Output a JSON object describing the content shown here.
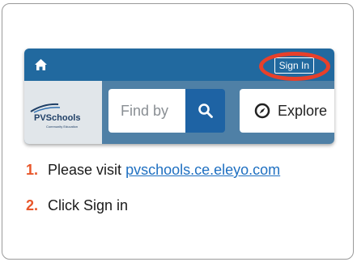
{
  "screenshot": {
    "signin_label": "Sign In",
    "logo_text": "PVSchools",
    "logo_subtext": "Community Education",
    "search_placeholder": "Find by",
    "explore_label": "Explore"
  },
  "steps": [
    {
      "number": "1.",
      "text": "Please visit ",
      "link": "pvschools.ce.eleyo.com"
    },
    {
      "number": "2.",
      "text": "Click Sign in"
    }
  ],
  "colors": {
    "topbar": "#21699f",
    "searchbar": "#4f80a6",
    "highlight": "#e8402a",
    "step_number": "#e8562a",
    "link": "#1f70c1"
  },
  "icons": [
    "home-icon",
    "search-icon",
    "compass-icon"
  ]
}
